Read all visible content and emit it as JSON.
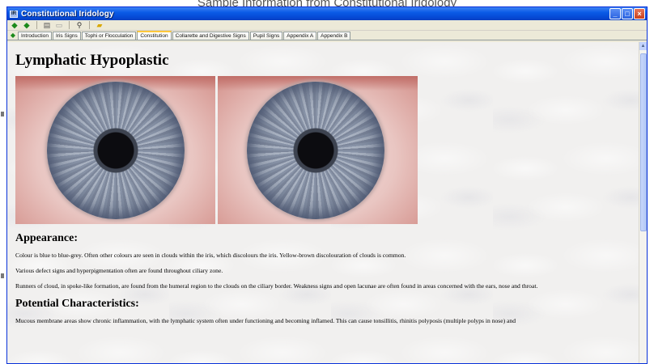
{
  "caption": "Sample Information from Constitutional Iridology",
  "window": {
    "title": "Constitutional Iridology",
    "controls": {
      "minimize": "_",
      "maximize": "□",
      "close": "×"
    }
  },
  "toolbar": {
    "icons": [
      "back-arrow-icon",
      "forward-arrow-icon",
      "print-icon",
      "copy-icon",
      "search-icon",
      "folder-icon"
    ]
  },
  "tabs": [
    {
      "label": "Introduction",
      "active": false
    },
    {
      "label": "Iris Signs",
      "active": false
    },
    {
      "label": "Tophi or Flocculation",
      "active": false
    },
    {
      "label": "Constitution",
      "active": true
    },
    {
      "label": "Collarette and Digestive Signs",
      "active": false
    },
    {
      "label": "Pupil Signs",
      "active": false
    },
    {
      "label": "Appendix A",
      "active": false
    },
    {
      "label": "Appendix B",
      "active": false
    }
  ],
  "page": {
    "heading": "Lymphatic Hypoplastic",
    "appearance": {
      "heading": "Appearance:",
      "paragraphs": [
        "Colour is blue to blue-grey. Often other colours are seen in clouds within the iris, which discolours the iris. Yellow-brown discolouration of clouds is common.",
        "Various defect signs and hyperpigmentation often are found throughout ciliary zone.",
        "Runners of cloud, in spoke-like formation, are found from the humeral region to the clouds on the ciliary border. Weakness signs and open lacunae are often found in areas concerned with the ears, nose and throat."
      ]
    },
    "characteristics": {
      "heading": "Potential Characteristics:",
      "paragraphs": [
        "Mucous membrane areas show chronic inflammation, with the lymphatic system often under functioning and becoming inflamed. This can cause tonsillitis, rhinitis polyposis (multiple polyps in nose) and"
      ]
    }
  },
  "colors": {
    "titlebar": "#0a5be6",
    "window_frame": "#ece9d8",
    "active_tab_accent": "#ffc83c",
    "content_background": "#f1f0ef"
  }
}
